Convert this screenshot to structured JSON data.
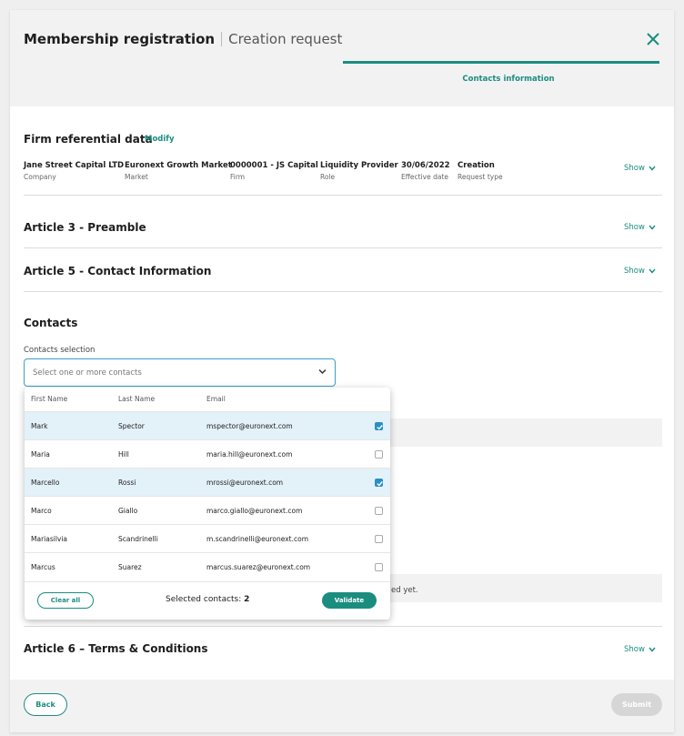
{
  "header": {
    "title": "Membership registration",
    "subtitle": "Creation request",
    "step_label": "Contacts information"
  },
  "firm": {
    "title": "Firm referential data",
    "modify_label": "Modify",
    "fields": [
      {
        "value": "Jane Street Capital LTD",
        "label": "Company"
      },
      {
        "value": "Euronext Growth Market",
        "label": "Market"
      },
      {
        "value": "0000001 - JS Capital",
        "label": "Firm"
      },
      {
        "value": "Liquidity Provider",
        "label": "Role"
      },
      {
        "value": "30/06/2022",
        "label": "Effective date"
      },
      {
        "value": "Creation",
        "label": "Request type"
      }
    ],
    "show_label": "Show"
  },
  "articles": {
    "a3": {
      "title": "Article 3 - Preamble",
      "show_label": "Show"
    },
    "a5": {
      "title": "Article 5 - Contact Information",
      "show_label": "Show"
    },
    "a6": {
      "title": "Article 6 – Terms & Conditions",
      "show_label": "Show"
    }
  },
  "contacts": {
    "title": "Contacts",
    "selection_label": "Contacts selection",
    "placeholder": "Select one or more contacts",
    "background_text": "ed yet."
  },
  "dropdown": {
    "columns": {
      "first": "First Name",
      "last": "Last Name",
      "email": "Email"
    },
    "rows": [
      {
        "first": "Mark",
        "last": "Spector",
        "email": "mspector@euronext.com",
        "checked": true
      },
      {
        "first": "Maria",
        "last": "Hill",
        "email": "maria.hill@euronext.com",
        "checked": false
      },
      {
        "first": "Marcello",
        "last": "Rossi",
        "email": "mrossi@euronext.com",
        "checked": true
      },
      {
        "first": "Marco",
        "last": "Giallo",
        "email": "marco.giallo@euronext.com",
        "checked": false
      },
      {
        "first": "Mariasilvia",
        "last": "Scandrinelli",
        "email": "m.scandrinelli@euronext.com",
        "checked": false
      },
      {
        "first": "Marcus",
        "last": "Suarez",
        "email": "marcus.suarez@euronext.com",
        "checked": false
      }
    ],
    "clear_label": "Clear all",
    "selected_prefix": "Selected contacts:",
    "selected_count": "2",
    "validate_label": "Validate"
  },
  "footer": {
    "back_label": "Back",
    "submit_label": "Submit"
  },
  "colors": {
    "accent": "#1b8d7f",
    "selected_row": "#e3f1f8",
    "checkbox": "#2a8fc4"
  }
}
